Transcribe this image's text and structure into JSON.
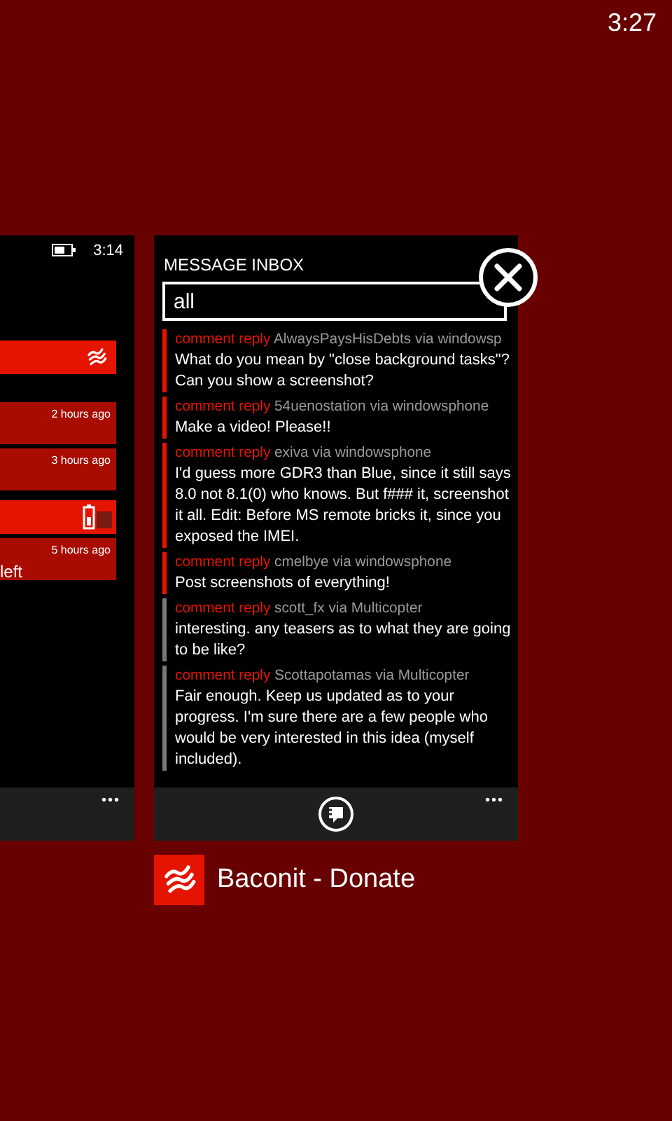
{
  "status_bar": {
    "time": "3:27"
  },
  "background_app": {
    "status_time": "3:14",
    "tiles": [
      {
        "kind": "app-banner"
      },
      {
        "kind": "note",
        "time": "2 hours ago"
      },
      {
        "kind": "note",
        "time": "3 hours ago"
      },
      {
        "kind": "battery-banner"
      },
      {
        "kind": "note",
        "time": "5 hours ago",
        "text": "left"
      }
    ],
    "more": "•••"
  },
  "active_app": {
    "header": "MESSAGE INBOX",
    "filter": {
      "value": "all"
    },
    "messages": [
      {
        "type": "comment reply",
        "author": "AlwaysPaysHisDebts via windowsp",
        "body": "What do you mean by \"close background tasks\"? Can you show a screenshot?",
        "unread": true
      },
      {
        "type": "comment reply",
        "author": "54uenostation via windowsphone",
        "body": "Make a video! Please!!",
        "unread": true
      },
      {
        "type": "comment reply",
        "author": "exiva via windowsphone",
        "body": "I'd guess more GDR3 than Blue, since it still says 8.0 not 8.1(0) who knows. But  f### it, screenshot it all. Edit: Before MS remote bricks it, since you exposed the IMEI.",
        "unread": true
      },
      {
        "type": "comment reply",
        "author": "cmelbye via windowsphone",
        "body": "Post screenshots of everything!",
        "unread": true
      },
      {
        "type": "comment reply",
        "author": "scott_fx via Multicopter",
        "body": "interesting.  any teasers as to what they are going to be like?",
        "unread": false
      },
      {
        "type": "comment reply",
        "author": "Scottapotamas via Multicopter",
        "body": "Fair enough. Keep us updated as to your progress. I'm sure there are a few people who would be very interested in this idea (myself included).",
        "unread": false
      }
    ],
    "more": "•••"
  },
  "app_title": "Baconit - Donate"
}
